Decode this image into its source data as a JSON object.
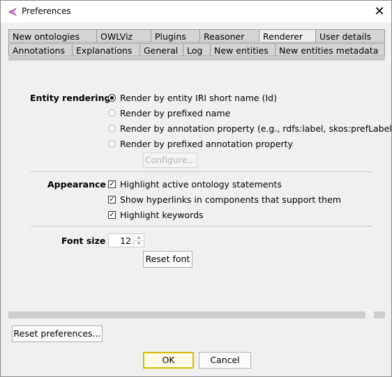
{
  "window": {
    "title": "Preferences"
  },
  "tabs": {
    "row1": [
      "New ontologies",
      "OWLViz",
      "Plugins",
      "Reasoner",
      "Renderer",
      "User details"
    ],
    "row2": [
      "Annotations",
      "Explanations",
      "General",
      "Log",
      "New entities",
      "New entities metadata"
    ],
    "selected": "Renderer"
  },
  "entity_rendering": {
    "label": "Entity rendering",
    "options": [
      "Render by entity IRI short name (Id)",
      "Render by prefixed name",
      "Render by annotation property (e.g., rdfs:label, skos:prefLabel)",
      "Render by prefixed annotation property"
    ],
    "selected_index": 0,
    "configure_label": "Configure..."
  },
  "appearance": {
    "label": "Appearance",
    "options": [
      "Highlight active ontology statements",
      "Show hyperlinks in components that support them",
      "Highlight keywords"
    ]
  },
  "font": {
    "label": "Font size",
    "value": "12",
    "reset_label": "Reset font"
  },
  "footer": {
    "reset_prefs_label": "Reset preferences...",
    "ok_label": "OK",
    "cancel_label": "Cancel"
  }
}
